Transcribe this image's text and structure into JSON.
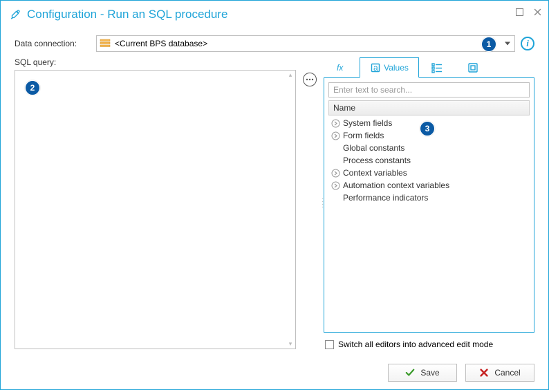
{
  "window": {
    "title": "Configuration - Run an SQL procedure"
  },
  "labels": {
    "data_connection": "Data connection:",
    "sql_query": "SQL query:"
  },
  "combo": {
    "selected": "<Current BPS database>"
  },
  "tabs": {
    "values_label": "Values"
  },
  "search": {
    "placeholder": "Enter text to search..."
  },
  "panel": {
    "header": "Name"
  },
  "tree": [
    {
      "label": "System fields",
      "expandable": true
    },
    {
      "label": "Form fields",
      "expandable": true
    },
    {
      "label": "Global constants",
      "expandable": false
    },
    {
      "label": "Process constants",
      "expandable": false
    },
    {
      "label": "Context variables",
      "expandable": true
    },
    {
      "label": "Automation context variables",
      "expandable": true
    },
    {
      "label": "Performance indicators",
      "expandable": false
    }
  ],
  "advanced": {
    "label": "Switch all editors into advanced edit mode"
  },
  "buttons": {
    "save": "Save",
    "cancel": "Cancel"
  },
  "badges": {
    "b1": "1",
    "b2": "2",
    "b3": "3"
  }
}
